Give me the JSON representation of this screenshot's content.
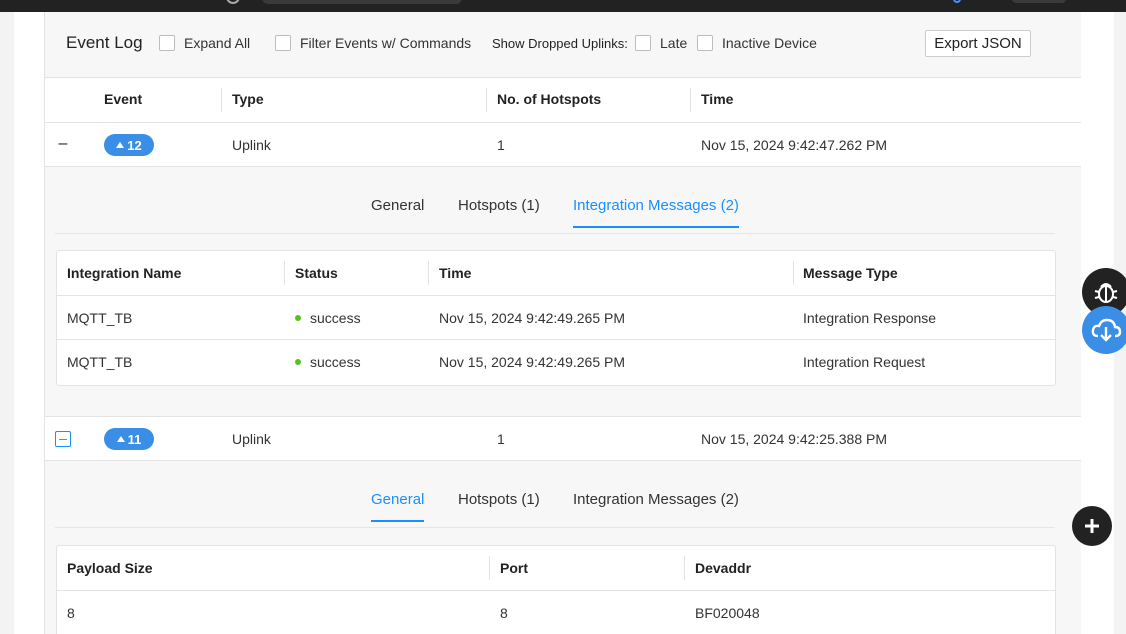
{
  "toolbar": {
    "title": "Event Log",
    "expand_all": "Expand All",
    "filter_commands": "Filter Events w/ Commands",
    "show_dropped": "Show Dropped Uplinks:",
    "late": "Late",
    "inactive_device": "Inactive Device",
    "export": "Export JSON"
  },
  "columns": {
    "event": "Event",
    "type": "Type",
    "hotspots": "No. of Hotspots",
    "time": "Time"
  },
  "events": [
    {
      "toggle": "–",
      "number": "12",
      "type": "Uplink",
      "hotspots": "1",
      "time": "Nov 15, 2024 9:42:47.262 PM",
      "tabs": [
        "General",
        "Hotspots (1)",
        "Integration Messages (2)"
      ],
      "active_tab": "Integration Messages (2)",
      "integration_table": {
        "headers": [
          "Integration Name",
          "Status",
          "Time",
          "Message Type"
        ],
        "rows": [
          {
            "name": "MQTT_TB",
            "status": "success",
            "time": "Nov 15, 2024 9:42:49.265 PM",
            "message_type": "Integration Response"
          },
          {
            "name": "MQTT_TB",
            "status": "success",
            "time": "Nov 15, 2024 9:42:49.265 PM",
            "message_type": "Integration Request"
          }
        ]
      }
    },
    {
      "toggle": "–",
      "number": "11",
      "type": "Uplink",
      "hotspots": "1",
      "time": "Nov 15, 2024 9:42:25.388 PM",
      "tabs": [
        "General",
        "Hotspots (1)",
        "Integration Messages (2)"
      ],
      "active_tab": "General",
      "general_table": {
        "headers": [
          "Payload Size",
          "Port",
          "Devaddr"
        ],
        "rows": [
          {
            "payload_size": "8",
            "port": "8",
            "devaddr": "BF020048"
          }
        ]
      }
    }
  ],
  "colors": {
    "accent": "#1890ff",
    "badge": "#3a8ee6",
    "success": "#52c41a",
    "fab_dark": "#222222",
    "fab_blue": "#3a8ee6"
  },
  "icons": [
    "bug-icon",
    "cloud-download-icon",
    "plus-icon",
    "caret-up-icon",
    "minus-icon"
  ]
}
